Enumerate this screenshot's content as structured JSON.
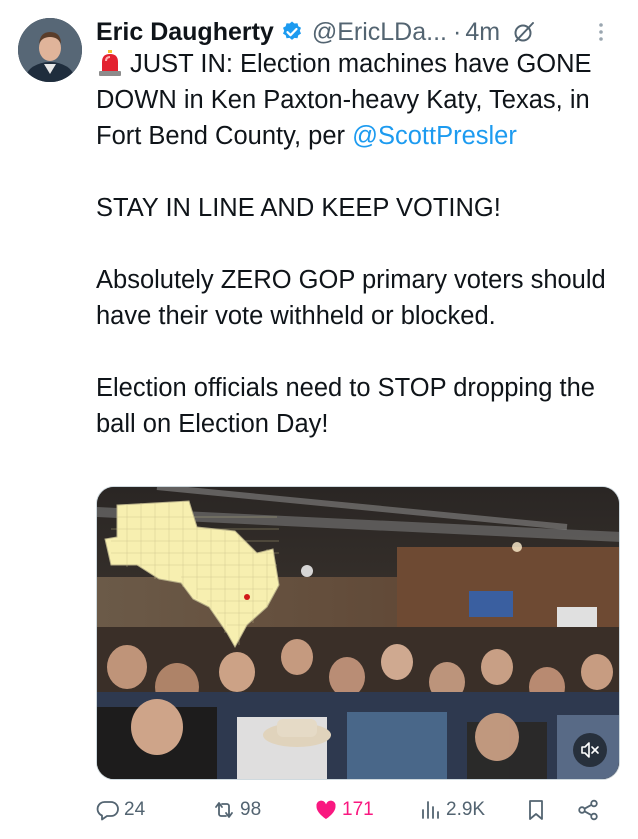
{
  "author": {
    "name": "Eric Daugherty",
    "handle": "@EricLDa...",
    "time_sep": "·",
    "time": "4m"
  },
  "tweet": {
    "line1": "JUST IN: Election machines have GONE DOWN in Ken Paxton-heavy Katy, Texas, in Fort Bend County, per ",
    "mention": "@ScottPresler",
    "para2": "STAY IN LINE AND KEEP VOTING!",
    "para3": "Absolutely ZERO GOP primary voters should have their vote withheld or blocked.",
    "para4": "Election officials need to STOP dropping the ball on Election Day!"
  },
  "icons": {
    "siren": "rotating-light-emoji",
    "verified": "verified-badge-icon",
    "grok": "grok-icon",
    "more": "more-dots-icon",
    "mute": "muted-speaker-icon"
  },
  "actions": {
    "replies": "24",
    "reposts": "98",
    "likes": "171",
    "views": "2.9K"
  },
  "colors": {
    "accent": "#1d9bf0",
    "like": "#f91880",
    "muted_text": "#536471"
  }
}
